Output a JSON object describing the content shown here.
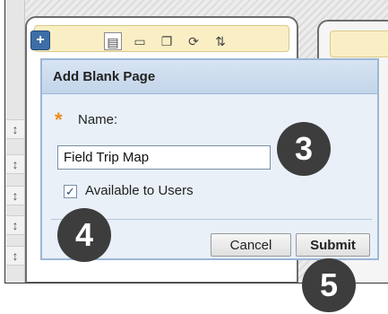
{
  "dialog": {
    "title": "Add Blank Page",
    "name_label": "Name:",
    "name_value": "Field Trip Map",
    "available_label": "Available to Users",
    "available_checked": true,
    "cancel_label": "Cancel",
    "submit_label": "Submit"
  },
  "toolbar": {
    "plus_label": "+",
    "icons": [
      "list-view-icon",
      "folder-icon",
      "window-icon",
      "refresh-icon",
      "sort-icon"
    ]
  },
  "rail": {
    "handle_icon": "drag-handle-icon",
    "handle_glyph": "↕"
  },
  "annotations": {
    "step3": "3",
    "step4": "4",
    "step5": "5"
  },
  "colors": {
    "required_star": "#f08a1c",
    "dialog_bg": "#e9f0f8",
    "badge": "#3d3d3d",
    "toolbar_bg": "#faefc4",
    "accent_blue": "#3d6ea7"
  }
}
